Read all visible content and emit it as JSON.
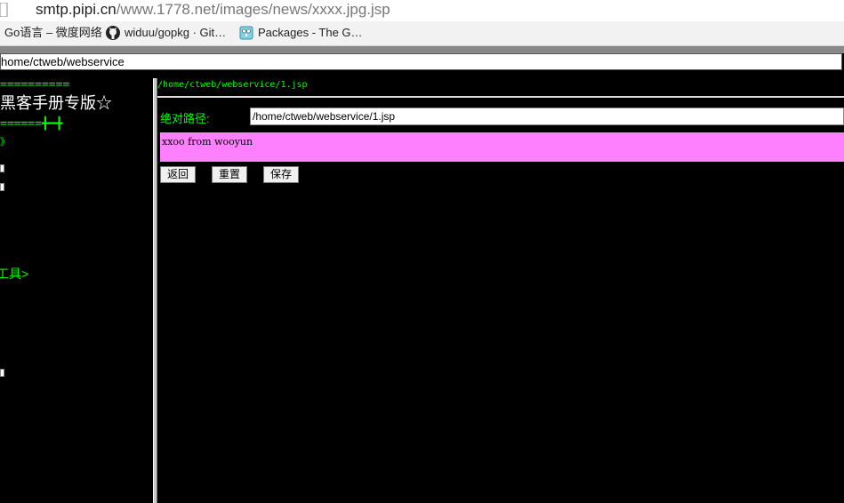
{
  "browser": {
    "url_host": "smtp.pipi.cn",
    "url_path": "/www.1778.net/images/news/xxxx.jpg.jsp",
    "bookmarks": [
      {
        "label": "Go语言 – 微度网络",
        "icon": "blank"
      },
      {
        "label": "widuu/gopkg · Git…",
        "icon": "github-icon"
      },
      {
        "label": "Packages - The G…",
        "icon": "go-gopher-icon"
      }
    ]
  },
  "top_path": {
    "value": "home/ctweb/webservice"
  },
  "left": {
    "rule1": "==========",
    "title": "黑客手册专版☆",
    "rule2": "======╋━╋",
    "arrow1": "》",
    "tools": "工具>"
  },
  "editor": {
    "file_path": "/home/ctweb/webservice/1.jsp",
    "abs_label": "绝对路径:",
    "abs_value": "/home/ctweb/webservice/1.jsp",
    "content": "xxoo from wooyun",
    "buttons": {
      "back": "返回",
      "reset": "重置",
      "save": "保存"
    }
  }
}
